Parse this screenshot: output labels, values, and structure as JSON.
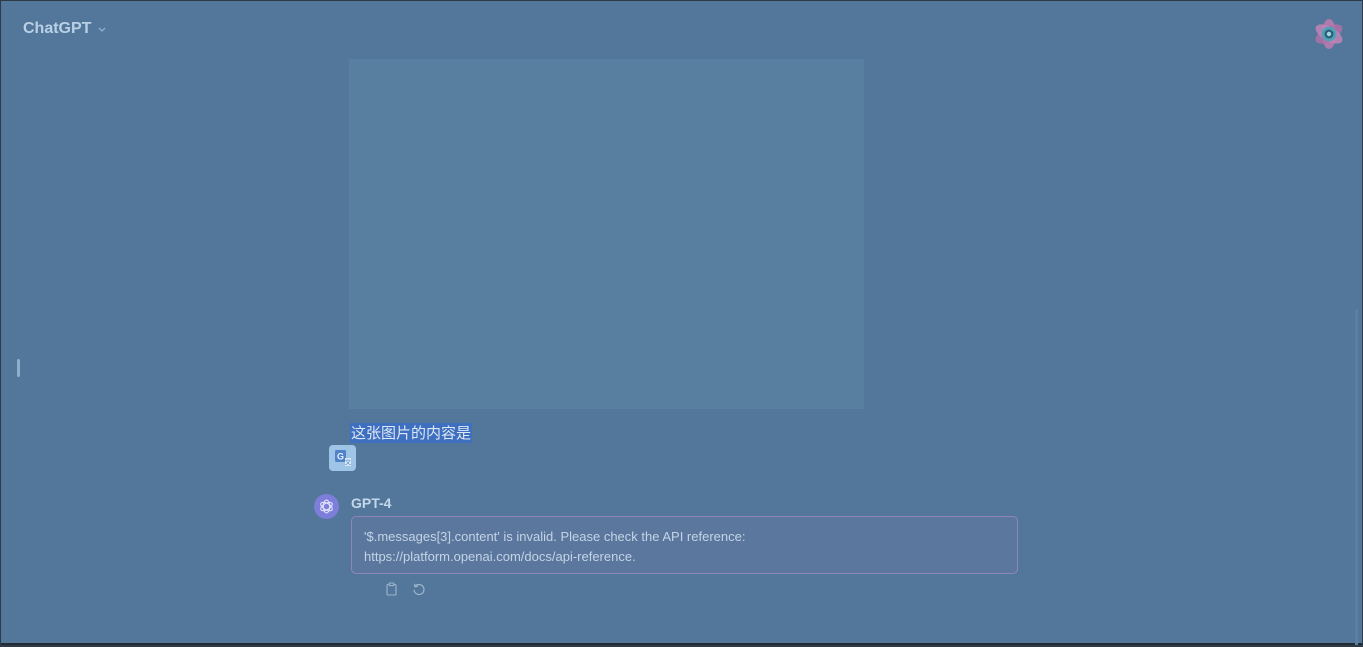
{
  "header": {
    "model_label": "ChatGPT",
    "chevron_icon": "chevron-down-icon",
    "avatar_icon": "flower-avatar-icon"
  },
  "conversation": {
    "user_message": {
      "image": "uploaded-image-placeholder",
      "text": "这张图片的内容是",
      "avatar_icon": "translate-icon"
    },
    "assistant_message": {
      "name": "GPT-4",
      "avatar_icon": "openai-logo-icon",
      "error_line_1": "'$.messages[3].content' is invalid. Please check the API reference:",
      "error_line_2": "https://platform.openai.com/docs/api-reference.",
      "actions": [
        {
          "icon": "clipboard-icon"
        },
        {
          "icon": "regenerate-icon"
        }
      ]
    }
  },
  "colors": {
    "background": "#53779a",
    "selection": "#3f6fbf",
    "error_border": "#8f86b8",
    "text": "#c3d4e6"
  }
}
